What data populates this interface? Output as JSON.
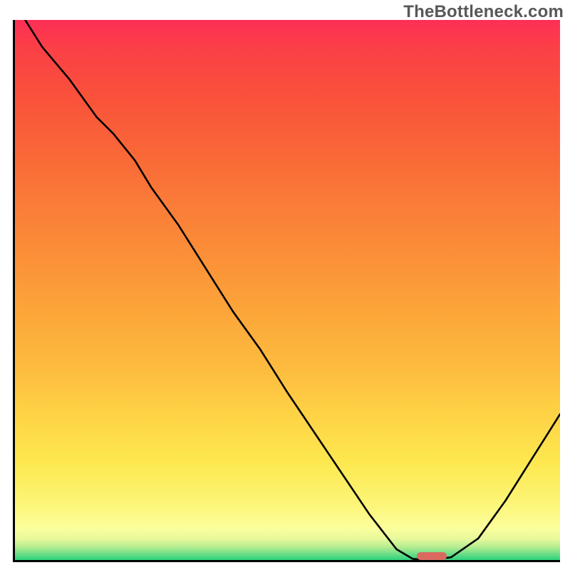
{
  "watermark": "TheBottleneck.com",
  "chart_data": {
    "type": "line",
    "title": "",
    "xlabel": "",
    "ylabel": "",
    "xlim": [
      0,
      100
    ],
    "ylim": [
      0,
      100
    ],
    "grid": false,
    "legend": false,
    "x": [
      0,
      5,
      10,
      15,
      18,
      22,
      25,
      30,
      35,
      40,
      45,
      50,
      55,
      60,
      65,
      70,
      73,
      76,
      80,
      85,
      90,
      95,
      100
    ],
    "y": [
      103,
      95,
      89,
      82,
      79,
      74,
      69,
      62,
      54,
      46,
      39,
      31,
      23.5,
      16,
      8.5,
      2,
      0.2,
      0,
      0.5,
      4,
      11,
      19,
      27
    ],
    "optimum_marker": {
      "x": 76.5,
      "y": 0.8,
      "width_pct": 5.5
    },
    "background_gradient": "red-to-green (top-to-bottom)",
    "annotations": []
  },
  "colors": {
    "axes": "#000000",
    "curve": "#000000",
    "marker": "#da6a60",
    "watermark": "#585858"
  }
}
